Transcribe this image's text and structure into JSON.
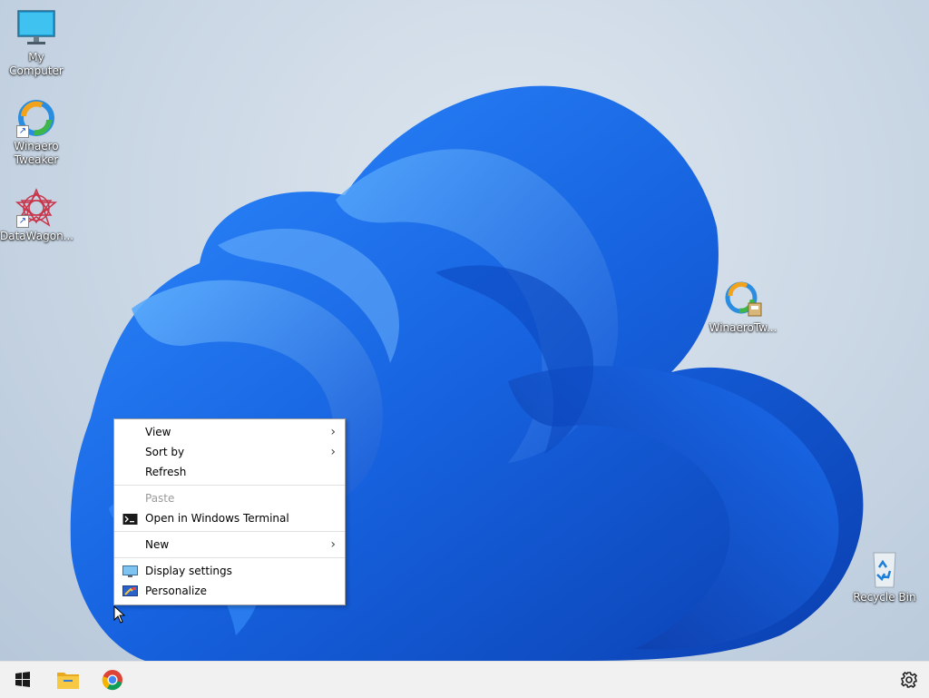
{
  "desktop": {
    "icons": [
      {
        "label": "My Computer",
        "icon": "monitor-icon"
      },
      {
        "label": "Winaero Tweaker",
        "label_line1": "Winaero",
        "label_line2": "Tweaker",
        "icon": "winaero-tweaker-icon"
      },
      {
        "label": "DataWagon...",
        "icon": "datawagon-icon"
      },
      {
        "label": "WinaeroTw...",
        "icon": "winaero-tweaker-installer-icon"
      },
      {
        "label": "Recycle Bin",
        "icon": "recycle-bin-icon"
      }
    ]
  },
  "context_menu": {
    "items": [
      {
        "label": "View",
        "submenu": true,
        "enabled": true
      },
      {
        "label": "Sort by",
        "submenu": true,
        "enabled": true
      },
      {
        "label": "Refresh",
        "submenu": false,
        "enabled": true
      },
      {
        "label": "Paste",
        "submenu": false,
        "enabled": false
      },
      {
        "label": "Open in Windows Terminal",
        "icon": "terminal-icon",
        "enabled": true
      },
      {
        "label": "New",
        "submenu": true,
        "enabled": true
      },
      {
        "label": "Display settings",
        "icon": "display-icon",
        "enabled": true
      },
      {
        "label": "Personalize",
        "icon": "personalize-icon",
        "enabled": true
      }
    ],
    "submenu_arrow": "›"
  },
  "taskbar": {
    "items": [
      {
        "name": "start",
        "icon": "windows-logo-icon"
      },
      {
        "name": "file-explorer",
        "icon": "folder-icon"
      },
      {
        "name": "chrome",
        "icon": "chrome-icon"
      }
    ],
    "tray": [
      {
        "name": "settings",
        "icon": "gear-icon"
      }
    ]
  },
  "colors": {
    "wallpaper_blue": "#1f6fe0",
    "taskbar": "#f1f1f1",
    "menu_bg": "#ffffff",
    "disabled_text": "#9a9a9a"
  }
}
